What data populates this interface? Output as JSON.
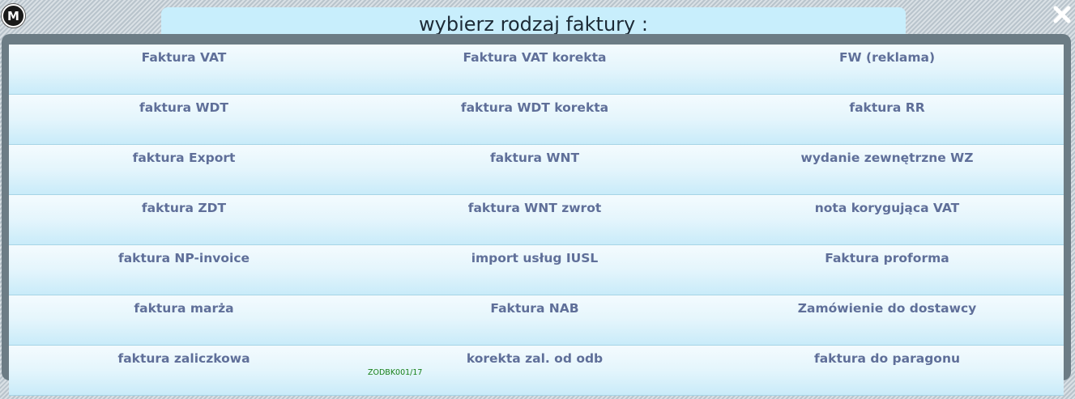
{
  "logo": {
    "text": "M"
  },
  "dialog": {
    "title": "wybierz rodzaj faktury :"
  },
  "options": [
    {
      "label": "Faktura VAT"
    },
    {
      "label": "Faktura VAT korekta"
    },
    {
      "label": "FW (reklama)"
    },
    {
      "label": "faktura WDT"
    },
    {
      "label": "faktura WDT korekta"
    },
    {
      "label": "faktura RR"
    },
    {
      "label": "faktura Export"
    },
    {
      "label": "faktura WNT"
    },
    {
      "label": "wydanie zewnętrzne WZ"
    },
    {
      "label": "faktura ZDT"
    },
    {
      "label": "faktura WNT zwrot"
    },
    {
      "label": "nota korygująca VAT"
    },
    {
      "label": "faktura NP-invoice"
    },
    {
      "label": "import usług IUSL"
    },
    {
      "label": "Faktura proforma"
    },
    {
      "label": "faktura marża"
    },
    {
      "label": "Faktura NAB"
    },
    {
      "label": "Zamówienie do dostawcy"
    },
    {
      "label": "faktura zaliczkowa"
    },
    {
      "label": "korekta zal. od odb",
      "note": "ZODBK001/17"
    },
    {
      "label": "faktura do paragonu"
    }
  ],
  "colors": {
    "title_bg": "#c8eefc",
    "label": "#5f6f99",
    "note": "#178017",
    "panel": "#6c7c85"
  },
  "icons": {
    "close": "close-icon",
    "logo": "logo-icon"
  }
}
